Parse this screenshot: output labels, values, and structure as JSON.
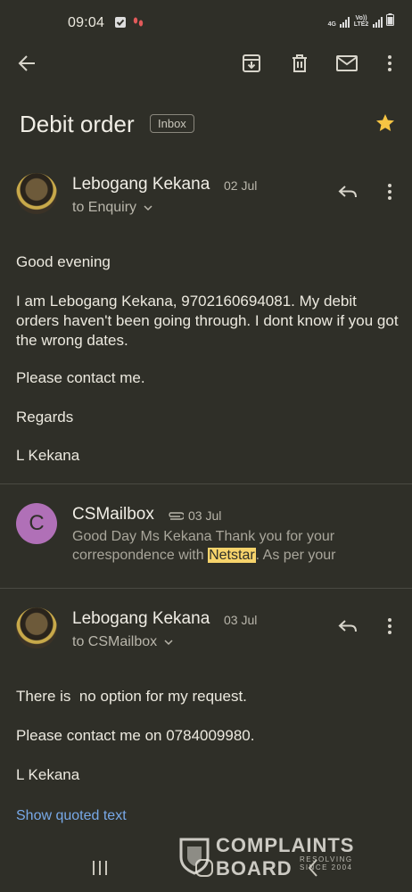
{
  "status_bar": {
    "time": "09:04",
    "network_4g": "4G",
    "volte": "Vo)) LTE2"
  },
  "email": {
    "subject": "Debit order",
    "label": "Inbox",
    "messages": [
      {
        "sender": "Lebogang Kekana",
        "date": "02 Jul",
        "recipient": "to Enquiry",
        "body": [
          "Good evening",
          "I am Lebogang Kekana, 9702160694081. My debit orders haven't been going through. I dont know if you got the wrong dates.",
          "Please contact me.",
          "Regards",
          "L Kekana"
        ]
      },
      {
        "sender": "CSMailbox",
        "avatar_letter": "C",
        "date": "03 Jul",
        "preview_before": "Good Day Ms Kekana Thank you for your correspondence with ",
        "preview_highlight": "Netstar",
        "preview_after": ". As per your"
      },
      {
        "sender": "Lebogang Kekana",
        "date": "03 Jul",
        "recipient": "to CSMailbox",
        "body": [
          "There is  no option for my request.",
          "Please contact me on 0784009980.",
          "L Kekana"
        ],
        "quoted_link": "Show quoted text"
      }
    ]
  },
  "watermark": {
    "name": "COMPLAINTS BOARD",
    "tagline": "RESOLVING",
    "since": "SINCE 2004"
  },
  "colors": {
    "background": "#2f2f28",
    "star": "#f6c443",
    "link": "#78a9e8",
    "avatar_c": "#b070b7"
  }
}
